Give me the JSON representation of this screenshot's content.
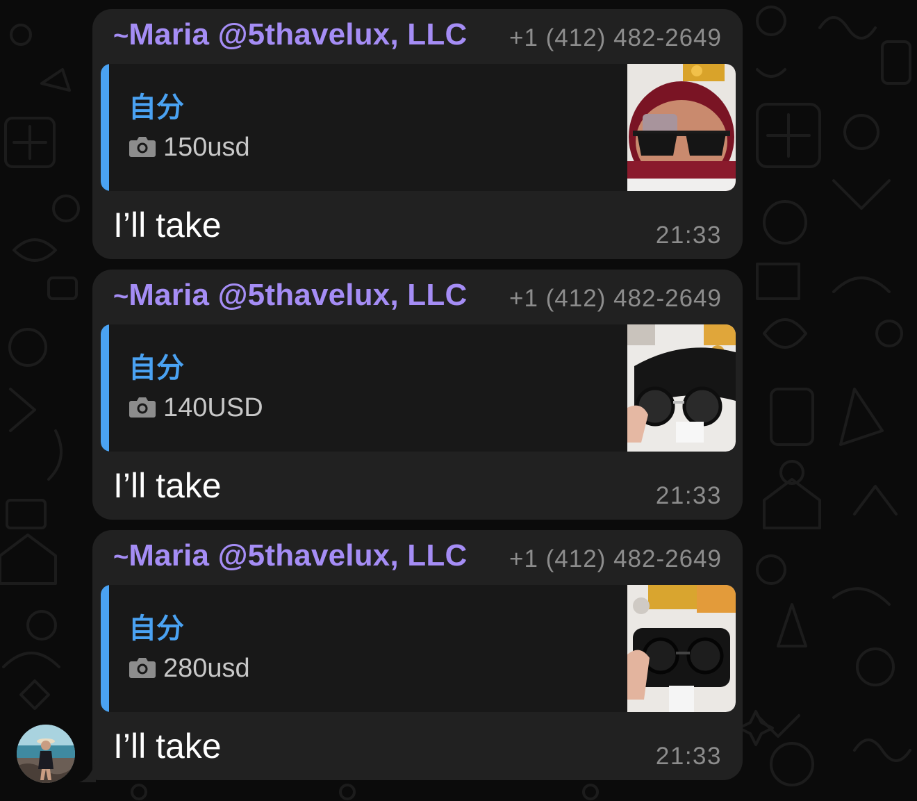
{
  "chat": {
    "messages": [
      {
        "sender_prefix": "~",
        "sender_name": "Maria @5thavelux, LLC",
        "sender_phone": "+1 (412) 482-2649",
        "reply": {
          "author": "自分",
          "media_icon": "camera-icon",
          "text": "150usd",
          "thumbnail": "red-glasses-case-with-sunglasses"
        },
        "text": "I’ll take",
        "time": "21:33"
      },
      {
        "sender_prefix": "~",
        "sender_name": "Maria @5thavelux, LLC",
        "sender_phone": "+1 (412) 482-2649",
        "reply": {
          "author": "自分",
          "media_icon": "camera-icon",
          "text": "140USD",
          "thumbnail": "hand-holding-sunglasses-black-case"
        },
        "text": "I’ll take",
        "time": "21:33"
      },
      {
        "sender_prefix": "~",
        "sender_name": "Maria @5thavelux, LLC",
        "sender_phone": "+1 (412) 482-2649",
        "reply": {
          "author": "自分",
          "media_icon": "camera-icon",
          "text": "280usd",
          "thumbnail": "hand-holding-sunglasses-on-case"
        },
        "text": "I’ll take",
        "time": "21:33"
      }
    ],
    "avatar": "user-avatar-photo"
  },
  "colors": {
    "background": "#0b0b0b",
    "bubble": "#212121",
    "quote_bg": "#181818",
    "sender_name": "#a58df5",
    "reply_accent": "#4aa2f2",
    "meta_text": "#8d8d8d",
    "message_text": "#ffffff"
  }
}
